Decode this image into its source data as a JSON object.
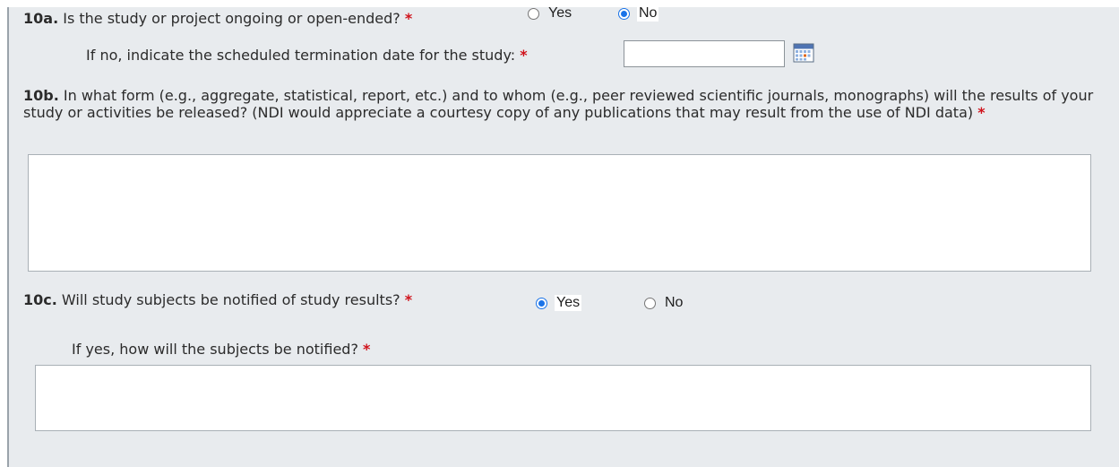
{
  "q10a": {
    "number": "10a.",
    "text": "Is the study or project ongoing or open-ended?",
    "required": "*",
    "options": {
      "yes": "Yes",
      "no": "No"
    },
    "selected": "No",
    "termination": {
      "label": "If no, indicate the scheduled termination date for the study:",
      "required": "*",
      "value": "",
      "calendar_icon": "calendar-icon"
    }
  },
  "q10b": {
    "number": "10b.",
    "text": "In what form (e.g., aggregate, statistical, report, etc.) and to whom (e.g., peer reviewed scientific journals, monographs) will the results of your study or activities be released? (NDI would appreciate a courtesy copy of any publications that may result from the use of NDI data)",
    "required": "*",
    "answer": ""
  },
  "q10c": {
    "number": "10c.",
    "text": "Will study subjects be notified of study results?",
    "required": "*",
    "options": {
      "yes": "Yes",
      "no": "No"
    },
    "selected": "Yes",
    "notify": {
      "label": "If yes, how will the subjects be notified?",
      "required": "*",
      "answer": ""
    }
  },
  "colors": {
    "panel_bg": "#e8ebee",
    "required": "#d0121b",
    "radio_accent": "#1a73e8"
  }
}
